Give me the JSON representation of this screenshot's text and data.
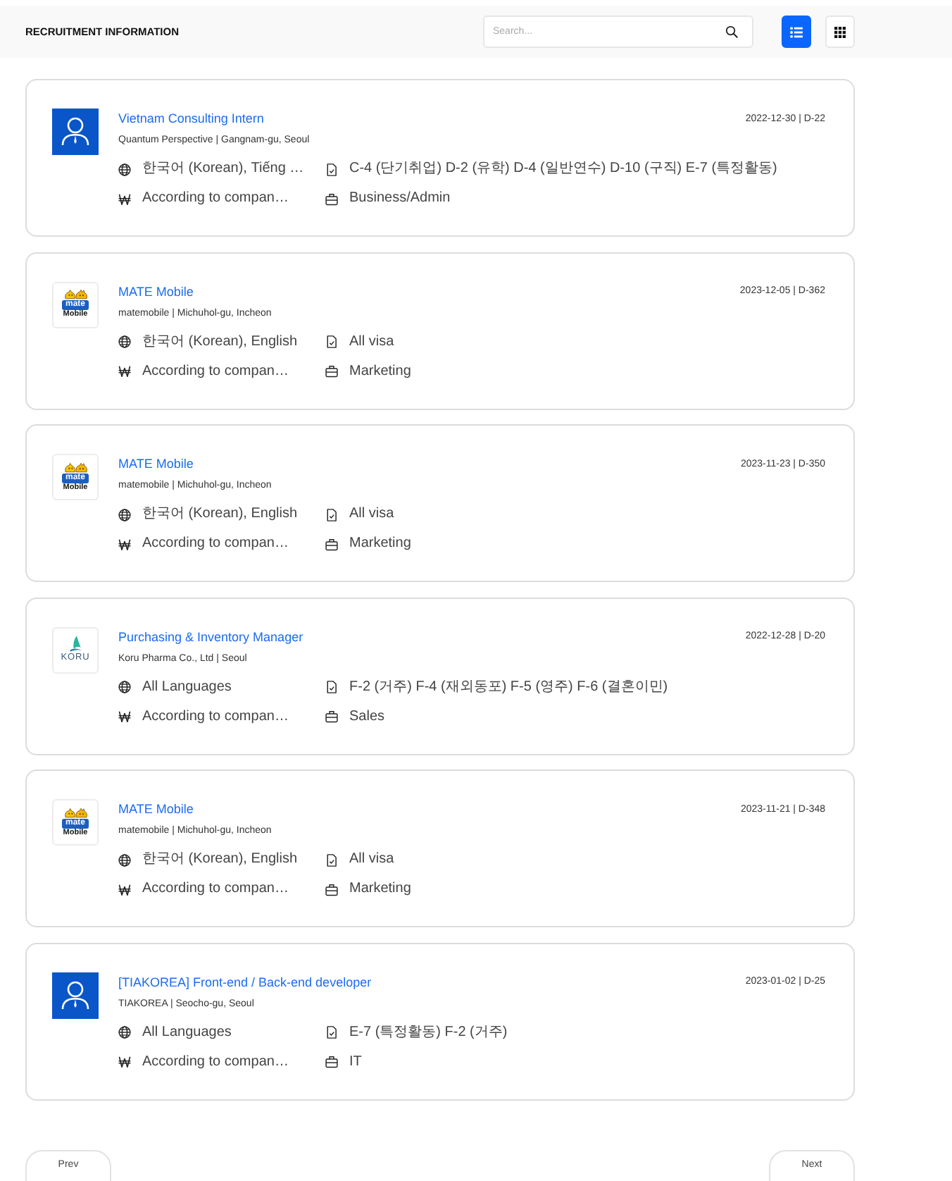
{
  "header": {
    "title": "RECRUITMENT INFORMATION",
    "search": {
      "placeholder": "Search..."
    },
    "view_buttons": [
      {
        "kind": "list",
        "selected": true
      },
      {
        "kind": "grid",
        "selected": false
      }
    ]
  },
  "jobs": [
    {
      "logo": {
        "kind": "avatar"
      },
      "title": "Vietnam Consulting Intern",
      "company": "Quantum Perspective | Gangnam-gu, Seoul",
      "deadline": "2022-12-30 | D-22",
      "languages": "한국어 (Korean), Tiếng …",
      "visa": "C-4 (단기취업) D-2 (유학) D-4 (일반연수) D-10 (구직) E-7 (특정활동)",
      "salary": "According to compan…",
      "category": "Business/Admin"
    },
    {
      "logo": {
        "kind": "mate",
        "wordmark": "mate",
        "caption": "Mobile"
      },
      "title": "MATE Mobile",
      "company": "matemobile | Michuhol-gu, Incheon",
      "deadline": "2023-12-05 | D-362",
      "languages": "한국어 (Korean), English",
      "visa": "All visa",
      "salary": "According to compan…",
      "category": "Marketing"
    },
    {
      "logo": {
        "kind": "mate",
        "wordmark": "mate",
        "caption": "Mobile"
      },
      "title": "MATE Mobile",
      "company": "matemobile | Michuhol-gu, Incheon",
      "deadline": "2023-11-23 | D-350",
      "languages": "한국어 (Korean), English",
      "visa": "All visa",
      "salary": "According to compan…",
      "category": "Marketing"
    },
    {
      "logo": {
        "kind": "koru",
        "wordmark": "KORU"
      },
      "title": "Purchasing & Inventory Manager",
      "company": "Koru Pharma Co., Ltd | Seoul",
      "deadline": "2022-12-28 | D-20",
      "languages": "All Languages",
      "visa": "F-2 (거주) F-4 (재외동포) F-5 (영주) F-6 (결혼이민)",
      "salary": "According to compan…",
      "category": "Sales"
    },
    {
      "logo": {
        "kind": "mate",
        "wordmark": "mate",
        "caption": "Mobile"
      },
      "title": "MATE Mobile",
      "company": "matemobile | Michuhol-gu, Incheon",
      "deadline": "2023-11-21 | D-348",
      "languages": "한국어 (Korean), English",
      "visa": "All visa",
      "salary": "According to compan…",
      "category": "Marketing"
    },
    {
      "logo": {
        "kind": "avatar"
      },
      "title": "[TIAKOREA] Front-end / Back-end developer",
      "company": "TIAKOREA | Seocho-gu, Seoul",
      "deadline": "2023-01-02 | D-25",
      "languages": "All Languages",
      "visa": "E-7 (특정활동) F-2 (거주)",
      "salary": "According to compan…",
      "category": "IT"
    }
  ],
  "pagination": {
    "prev": "Prev",
    "next": "Next"
  }
}
